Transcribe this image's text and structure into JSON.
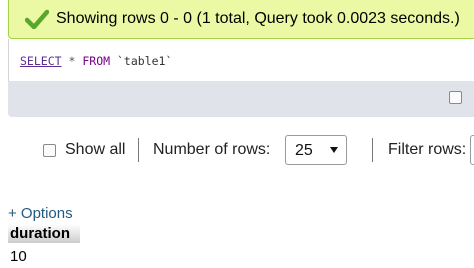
{
  "success_message": {
    "text": "Showing rows 0 - 0 (1 total, Query took 0.0023 seconds.)",
    "icon": "checkmark-icon",
    "background_color": "#ebf8a4",
    "icon_color": "#5aa52b"
  },
  "sql_query": {
    "keyword_select": "SELECT",
    "operator_star": "*",
    "keyword_from": "FROM",
    "table_name": "`table1`"
  },
  "navigation": {
    "show_all_label": "Show all",
    "show_all_checked": false,
    "number_of_rows_label": "Number of rows:",
    "number_of_rows_value": "25",
    "filter_rows_label": "Filter rows:",
    "filter_rows_value": ""
  },
  "options_link": "+ Options",
  "results": {
    "columns": [
      "duration"
    ],
    "rows": [
      [
        "10"
      ]
    ]
  }
}
